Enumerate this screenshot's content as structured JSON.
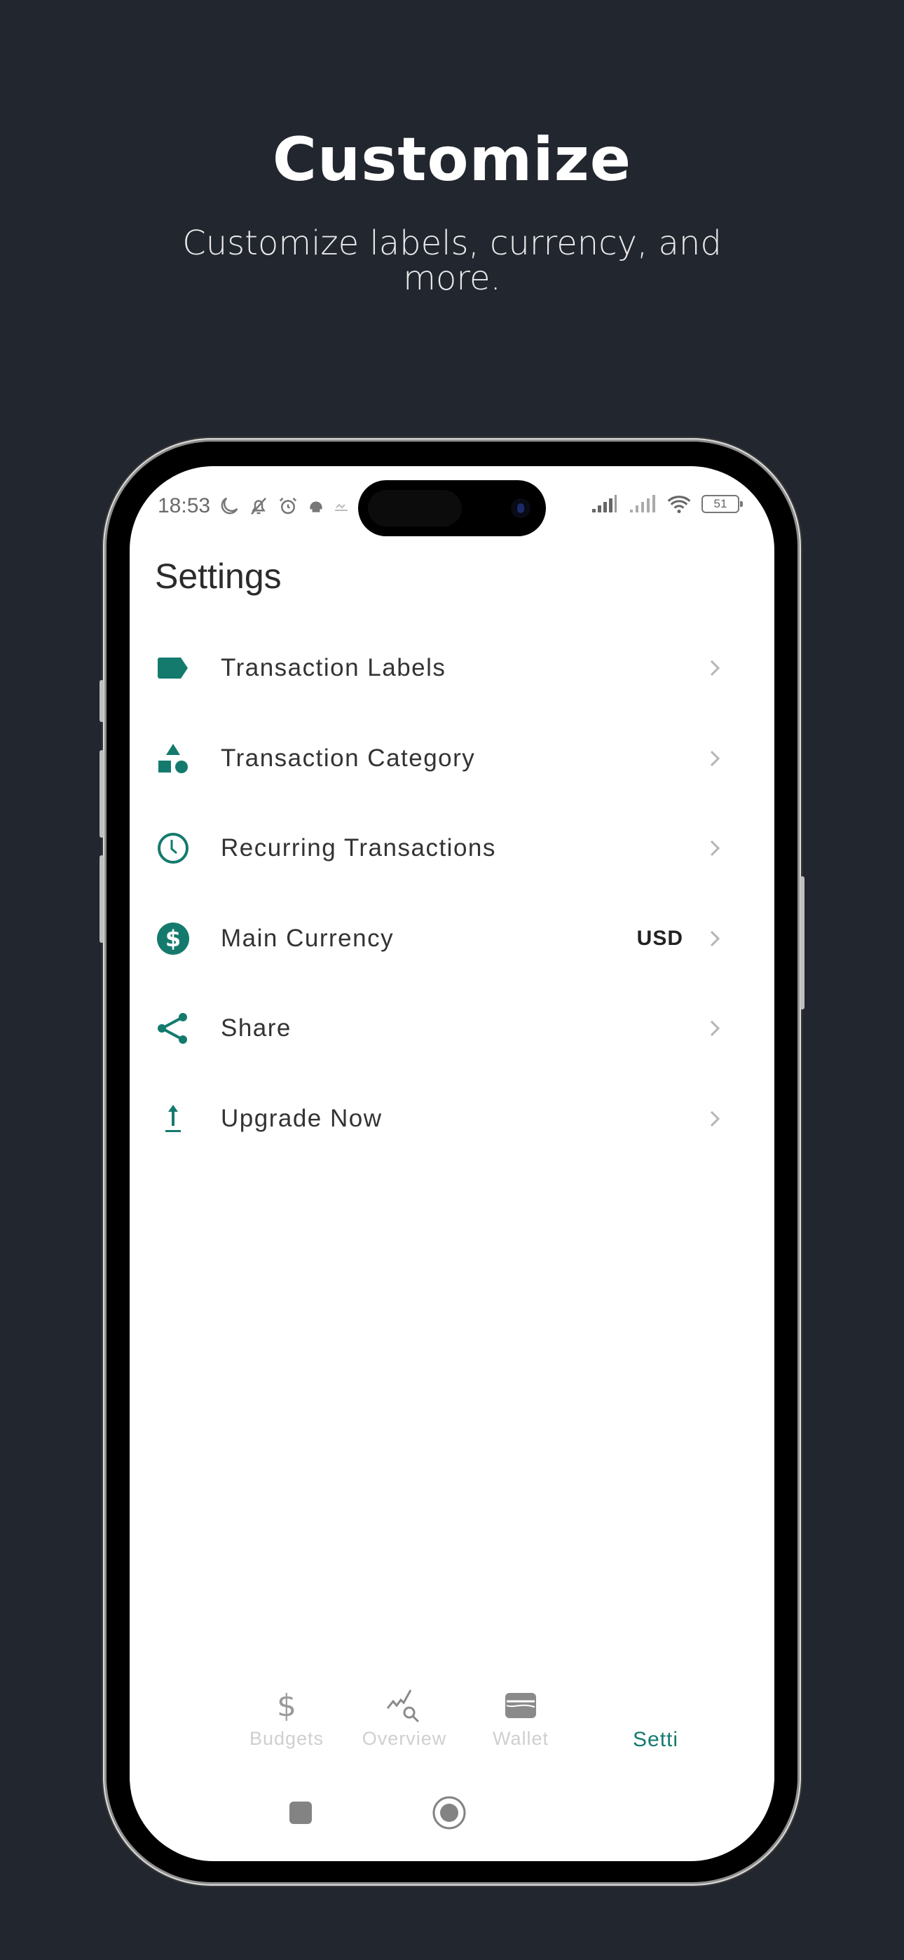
{
  "hero": {
    "title": "Customize",
    "subtitle": "Customize labels, currency, and more."
  },
  "status_bar": {
    "time": "18:53",
    "left_icons": [
      "moon-icon",
      "bell-off-icon",
      "alarm-icon",
      "helmet-icon",
      "data-speed-icon"
    ],
    "right_icons": [
      "signal-icon",
      "signal-weak-icon",
      "wifi-icon",
      "battery-icon"
    ],
    "battery_level": "51"
  },
  "screen": {
    "title": "Settings",
    "accent_color": "#157a6e",
    "items": [
      {
        "icon": "label-icon",
        "label": "Transaction Labels",
        "value": ""
      },
      {
        "icon": "category-shapes-icon",
        "label": "Transaction Category",
        "value": ""
      },
      {
        "icon": "clock-icon",
        "label": "Recurring Transactions",
        "value": ""
      },
      {
        "icon": "dollar-circle-icon",
        "label": "Main Currency",
        "value": "USD"
      },
      {
        "icon": "share-icon",
        "label": "Share",
        "value": ""
      },
      {
        "icon": "upgrade-arrow-icon",
        "label": "Upgrade Now",
        "value": ""
      }
    ]
  },
  "bottom_nav": {
    "items": [
      {
        "icon": "dollar-icon",
        "label": "Budgets",
        "active": false
      },
      {
        "icon": "chart-search-icon",
        "label": "Overview",
        "active": false
      },
      {
        "icon": "wallet-icon",
        "label": "Wallet",
        "active": false
      },
      {
        "icon": "settings-icon",
        "label": "Setti",
        "active": true
      }
    ]
  },
  "system_nav": {
    "buttons": [
      "recents-button",
      "home-button"
    ]
  }
}
